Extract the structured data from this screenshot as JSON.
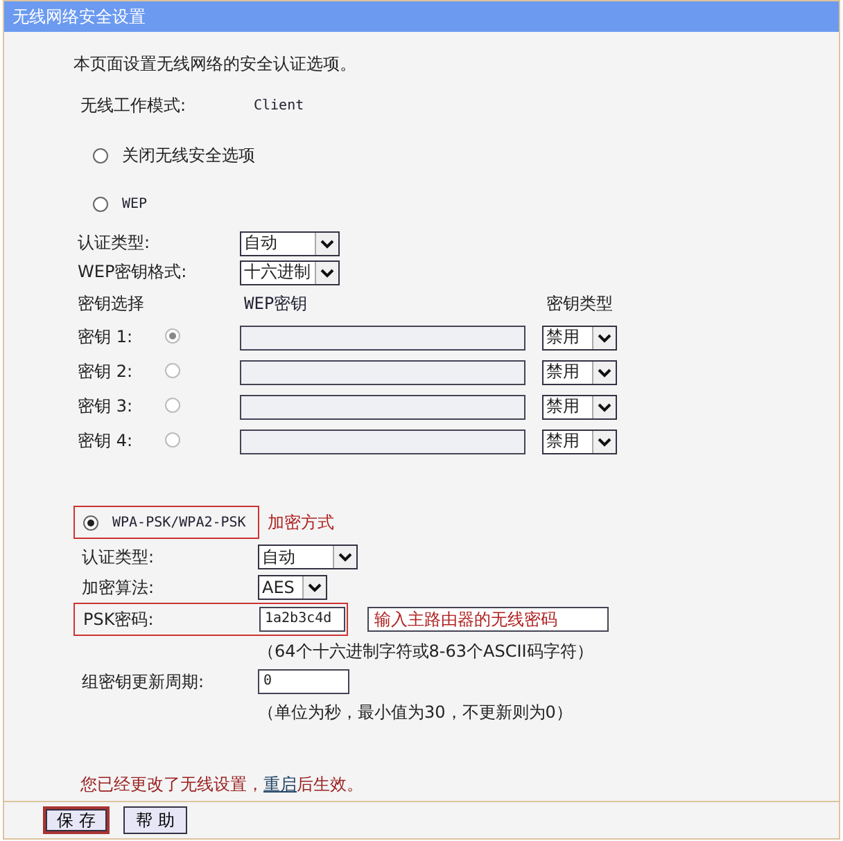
{
  "window": {
    "title": "无线网络安全设置"
  },
  "intro": "本页面设置无线网络的安全认证选项。",
  "mode": {
    "label": "无线工作模式:",
    "value": "Client"
  },
  "disable_option": {
    "label": "关闭无线安全选项",
    "selected": false
  },
  "wep": {
    "label": "WEP",
    "selected": false,
    "auth_type": {
      "label": "认证类型:",
      "value": "自动"
    },
    "key_format": {
      "label": "WEP密钥格式:",
      "value": "十六进制"
    },
    "columns": [
      "密钥选择",
      "WEP密钥",
      "密钥类型"
    ],
    "keys": [
      {
        "label": "密钥 1:",
        "selected": true,
        "type": "禁用"
      },
      {
        "label": "密钥 2:",
        "selected": false,
        "type": "禁用"
      },
      {
        "label": "密钥 3:",
        "selected": false,
        "type": "禁用"
      },
      {
        "label": "密钥 4:",
        "selected": false,
        "type": "禁用"
      }
    ]
  },
  "wpa": {
    "label": "WPA-PSK/WPA2-PSK",
    "selected": true,
    "annotation": "加密方式",
    "auth_type": {
      "label": "认证类型:",
      "value": "自动"
    },
    "algorithm": {
      "label": "加密算法:",
      "value": "AES"
    },
    "psk": {
      "label": "PSK密码:",
      "value": "1a2b3c4d",
      "annotation": "输入主路由器的无线密码",
      "hint": "（64个十六进制字符或8-63个ASCII码字符）"
    },
    "group_key_period": {
      "label": "组密钥更新周期:",
      "value": "0",
      "hint": "（单位为秒，最小值为30，不更新则为0）"
    }
  },
  "notice": {
    "before": "您已经更改了无线设置，",
    "link": "重启",
    "after": "后生效。"
  },
  "buttons": [
    {
      "label": "保 存",
      "focused": true
    },
    {
      "label": "帮 助",
      "focused": false
    }
  ]
}
